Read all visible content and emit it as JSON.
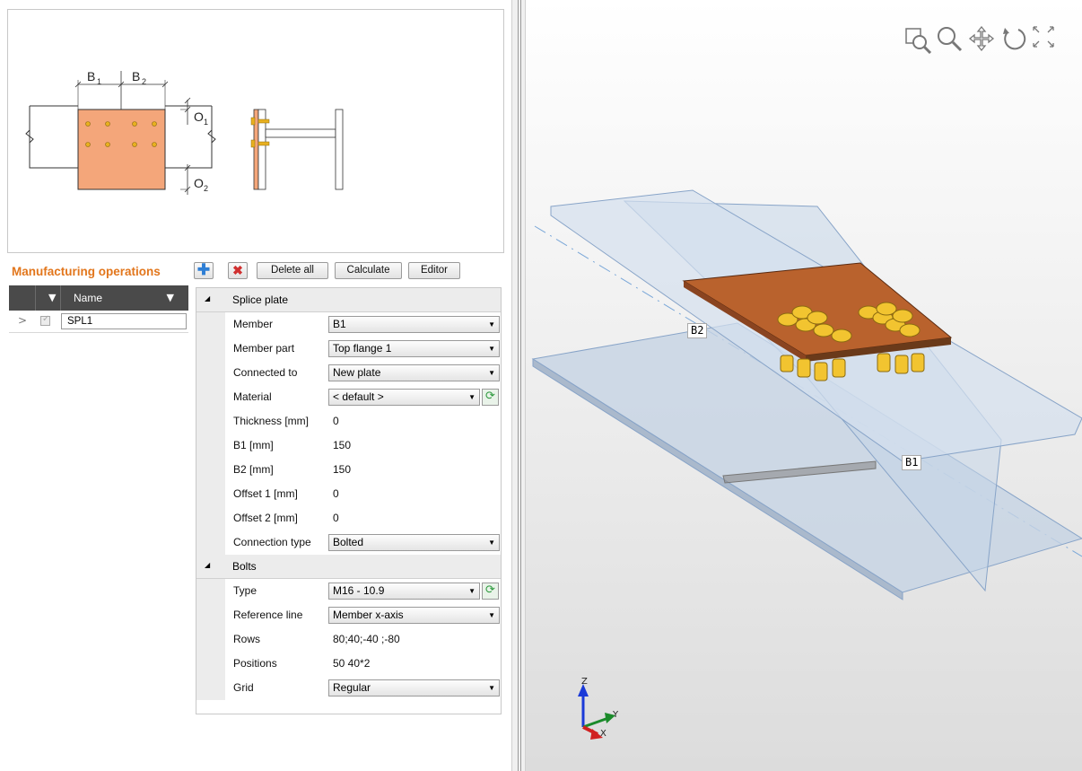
{
  "preview": {
    "labels": [
      "B",
      "1",
      "B",
      "2",
      "O",
      "1",
      "O",
      "2"
    ]
  },
  "manufacturing": {
    "title": "Manufacturing operations",
    "buttons": {
      "delete_all": "Delete all",
      "calculate": "Calculate",
      "editor": "Editor"
    }
  },
  "tree": {
    "header_name": "Name",
    "rows": [
      {
        "label": "SPL1",
        "checked": true
      }
    ]
  },
  "props": {
    "splice_plate": {
      "title": "Splice plate",
      "member_label": "Member",
      "member_value": "B1",
      "member_part_label": "Member part",
      "member_part_value": "Top flange 1",
      "connected_to_label": "Connected to",
      "connected_to_value": "New plate",
      "material_label": "Material",
      "material_value": "< default >",
      "thickness_label": "Thickness [mm]",
      "thickness_value": "0",
      "b1_label": "B1 [mm]",
      "b1_value": "150",
      "b2_label": "B2 [mm]",
      "b2_value": "150",
      "offset1_label": "Offset 1 [mm]",
      "offset1_value": "0",
      "offset2_label": "Offset 2 [mm]",
      "offset2_value": "0",
      "connection_type_label": "Connection type",
      "connection_type_value": "Bolted"
    },
    "bolts": {
      "title": "Bolts",
      "type_label": "Type",
      "type_value": "M16 - 10.9",
      "reference_line_label": "Reference line",
      "reference_line_value": "Member x-axis",
      "rows_label": "Rows",
      "rows_value": "80;40;-40 ;-80",
      "positions_label": "Positions",
      "positions_value": "50 40*2",
      "grid_label": "Grid",
      "grid_value": "Regular"
    }
  },
  "viewport": {
    "label_b1": "B1",
    "label_b2": "B2",
    "axis_z": "Z",
    "axis_y": "Y",
    "axis_x": "X",
    "tools": [
      "zoom-window-icon",
      "zoom-icon",
      "pan-icon",
      "rotate-icon",
      "fit-view-icon"
    ]
  },
  "colors": {
    "accent_orange": "#e2761c",
    "plate": "#f4a67a",
    "plate_3d": "#b9622d",
    "bolt": "#f2c430",
    "steel_blue": "#b7c9de"
  }
}
